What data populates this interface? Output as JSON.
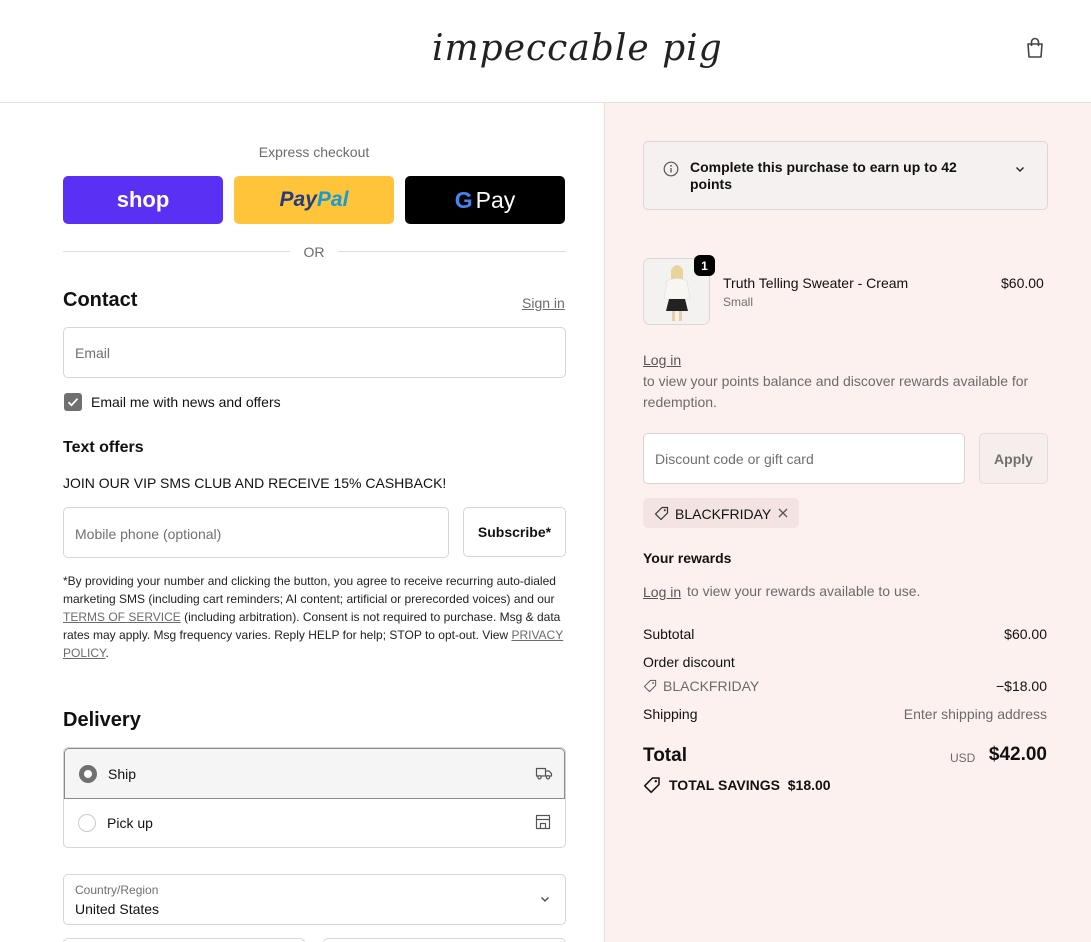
{
  "header": {
    "logo_text": "impeccable pig",
    "bag_icon": "shopping-bag-icon"
  },
  "express": {
    "title": "Express checkout",
    "shop_label": "shop",
    "paypal_part1": "Pay",
    "paypal_part2": "Pal",
    "gpay_g": "G",
    "gpay_label": "Pay",
    "or_label": "OR"
  },
  "contact": {
    "heading": "Contact",
    "sign_in": "Sign in",
    "email_placeholder": "Email",
    "news_checkbox_label": "Email me with news and offers",
    "news_checked": true
  },
  "text_offers": {
    "heading": "Text offers",
    "promo": "JOIN OUR VIP SMS CLUB AND RECEIVE 15% CASHBACK!",
    "phone_placeholder": "Mobile phone (optional)",
    "subscribe_label": "Subscribe*",
    "fineprint_1": "*By providing your number and clicking the button, you agree to receive recurring auto-dialed marketing SMS (including cart reminders; AI content; artificial or prerecorded voices) and our ",
    "tos_link": "TERMS OF SERVICE",
    "fineprint_2": " (including arbitration). Consent is not required to purchase. Msg & data rates may apply. Msg frequency varies. Reply HELP for help; STOP to opt-out. View ",
    "privacy_link": "PRIVACY POLICY",
    "fineprint_3": "."
  },
  "delivery": {
    "heading": "Delivery",
    "options": [
      {
        "label": "Ship",
        "selected": true,
        "icon": "truck-icon"
      },
      {
        "label": "Pick up",
        "selected": false,
        "icon": "store-icon"
      }
    ],
    "country_label": "Country/Region",
    "country_value": "United States"
  },
  "summary": {
    "points_banner": "Complete this purchase to earn up to 42 points",
    "product": {
      "quantity": "1",
      "name": "Truth Telling Sweater - Cream",
      "variant": "Small",
      "price": "$60.00"
    },
    "login_link": "Log in",
    "login_text": "to view your points balance and discover rewards available for redemption.",
    "discount_placeholder": "Discount code or gift card",
    "apply_label": "Apply",
    "applied_code": "BLACKFRIDAY",
    "rewards_heading": "Your rewards",
    "rewards_login_link": "Log in",
    "rewards_text": "to view your rewards available to use.",
    "subtotal_label": "Subtotal",
    "subtotal_value": "$60.00",
    "order_discount_label": "Order discount",
    "discount_code": "BLACKFRIDAY",
    "discount_value": "−$18.00",
    "shipping_label": "Shipping",
    "shipping_value": "Enter shipping address",
    "total_label": "Total",
    "currency": "USD",
    "total_value": "$42.00",
    "savings_label": "TOTAL SAVINGS",
    "savings_value": "$18.00"
  },
  "colors": {
    "shop_purple": "#5a31f4",
    "paypal_yellow": "#ffc439",
    "summary_bg": "#fdf1ef"
  }
}
